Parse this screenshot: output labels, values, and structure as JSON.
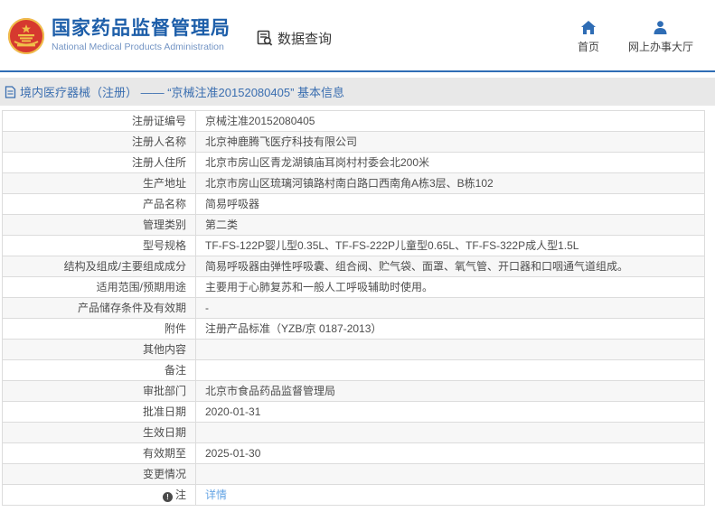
{
  "header": {
    "title": "国家药品监督管理局",
    "subtitle": "National Medical Products Administration",
    "query_label": "数据查询",
    "nav": [
      {
        "icon": "home-icon",
        "label": "首页"
      },
      {
        "icon": "user-icon",
        "label": "网上办事大厅"
      }
    ]
  },
  "breadcrumb": {
    "text": "境内医疗器械（注册） —— “京械注准20152080405” 基本信息"
  },
  "table": {
    "rows": [
      {
        "label": "注册证编号",
        "value": "京械注准20152080405"
      },
      {
        "label": "注册人名称",
        "value": "北京神鹿腾飞医疗科技有限公司"
      },
      {
        "label": "注册人住所",
        "value": "北京市房山区青龙湖镇庙耳岗村村委会北200米"
      },
      {
        "label": "生产地址",
        "value": "北京市房山区琉璃河镇路村南白路口西南角A栋3层、B栋102"
      },
      {
        "label": "产品名称",
        "value": "简易呼吸器"
      },
      {
        "label": "管理类别",
        "value": "第二类"
      },
      {
        "label": "型号规格",
        "value": "TF-FS-122P婴儿型0.35L、TF-FS-222P儿童型0.65L、TF-FS-322P成人型1.5L"
      },
      {
        "label": "结构及组成/主要组成成分",
        "value": "简易呼吸器由弹性呼吸囊、组合阀、贮气袋、面罩、氧气管、开口器和口咽通气道组成。"
      },
      {
        "label": "适用范围/预期用途",
        "value": "主要用于心肺复苏和一般人工呼吸辅助时使用。"
      },
      {
        "label": "产品储存条件及有效期",
        "value": "-"
      },
      {
        "label": "附件",
        "value": "注册产品标准（YZB/京 0187-2013）"
      },
      {
        "label": "其他内容",
        "value": ""
      },
      {
        "label": "备注",
        "value": ""
      },
      {
        "label": "审批部门",
        "value": "北京市食品药品监督管理局"
      },
      {
        "label": "批准日期",
        "value": "2020-01-31"
      },
      {
        "label": "生效日期",
        "value": ""
      },
      {
        "label": "有效期至",
        "value": "2025-01-30"
      },
      {
        "label": "变更情况",
        "value": ""
      },
      {
        "label": "注",
        "value": "详情",
        "is_link": true,
        "has_icon": true,
        "icon": "note-icon"
      }
    ]
  },
  "colors": {
    "title_blue": "#1d5ea9",
    "subtitle_blue": "#7394c4",
    "nav_blue": "#2f6db5",
    "divider_blue": "#2f6db5",
    "breadcrumb_bg": "#e8e8e8",
    "breadcrumb_text": "#3a6eb0",
    "table_border": "#dcdcdc",
    "stripe_bg": "#f7f7f7",
    "text": "#4d4d4d",
    "link_blue": "#64a4e4",
    "emblem_red": "#d6392f",
    "emblem_gold": "#f0c04a"
  }
}
